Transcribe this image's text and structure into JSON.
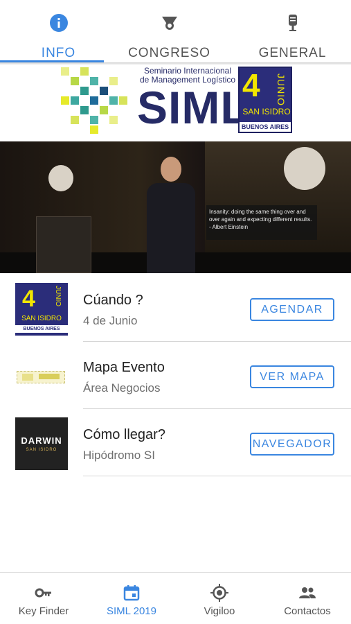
{
  "colors": {
    "accent": "#3a86e0",
    "inactive": "#555555",
    "brand_navy": "#2b2d7a",
    "brand_yellow": "#f2e600"
  },
  "top_tabs": [
    {
      "label": "INFO",
      "icon": "info-icon",
      "active": true
    },
    {
      "label": "CONGRESO",
      "icon": "certificate-icon",
      "active": false
    },
    {
      "label": "GENERAL",
      "icon": "microphone-icon",
      "active": false
    }
  ],
  "banner": {
    "subtitle_line1": "Seminario Internacional",
    "subtitle_line2": "de Management Logístico",
    "logo_text": "SIML",
    "date_number": "4",
    "date_month": "JUNIO",
    "location": "SAN ISIDRO",
    "city": "BUENOS AIRES"
  },
  "hero": {
    "quote_text": "Insanity: doing the same thing over and over again and expecting different results.",
    "quote_author": "- Albert Einstein"
  },
  "list": [
    {
      "title": "Cúando ?",
      "subtitle": "4 de Junio",
      "action": "AGENDAR",
      "thumb": "date-badge"
    },
    {
      "title": "Mapa Evento",
      "subtitle": "Área Negocios",
      "action": "VER MAPA",
      "thumb": "map"
    },
    {
      "title": "Cómo llegar?",
      "subtitle": "Hipódromo SI",
      "action": "NAVEGADOR",
      "thumb": "darwin"
    }
  ],
  "thumbs": {
    "date_number": "4",
    "date_month": "JUNIO",
    "location": "SAN ISIDRO",
    "city": "BUENOS AIRES",
    "darwin_name": "DARWIN",
    "darwin_sub": "SAN ISIDRO"
  },
  "bottom_nav": [
    {
      "label": "Key Finder",
      "icon": "key-icon",
      "active": false
    },
    {
      "label": "SIML 2019",
      "icon": "calendar-icon",
      "active": true
    },
    {
      "label": "Vigiloo",
      "icon": "location-target-icon",
      "active": false
    },
    {
      "label": "Contactos",
      "icon": "people-icon",
      "active": false
    }
  ]
}
